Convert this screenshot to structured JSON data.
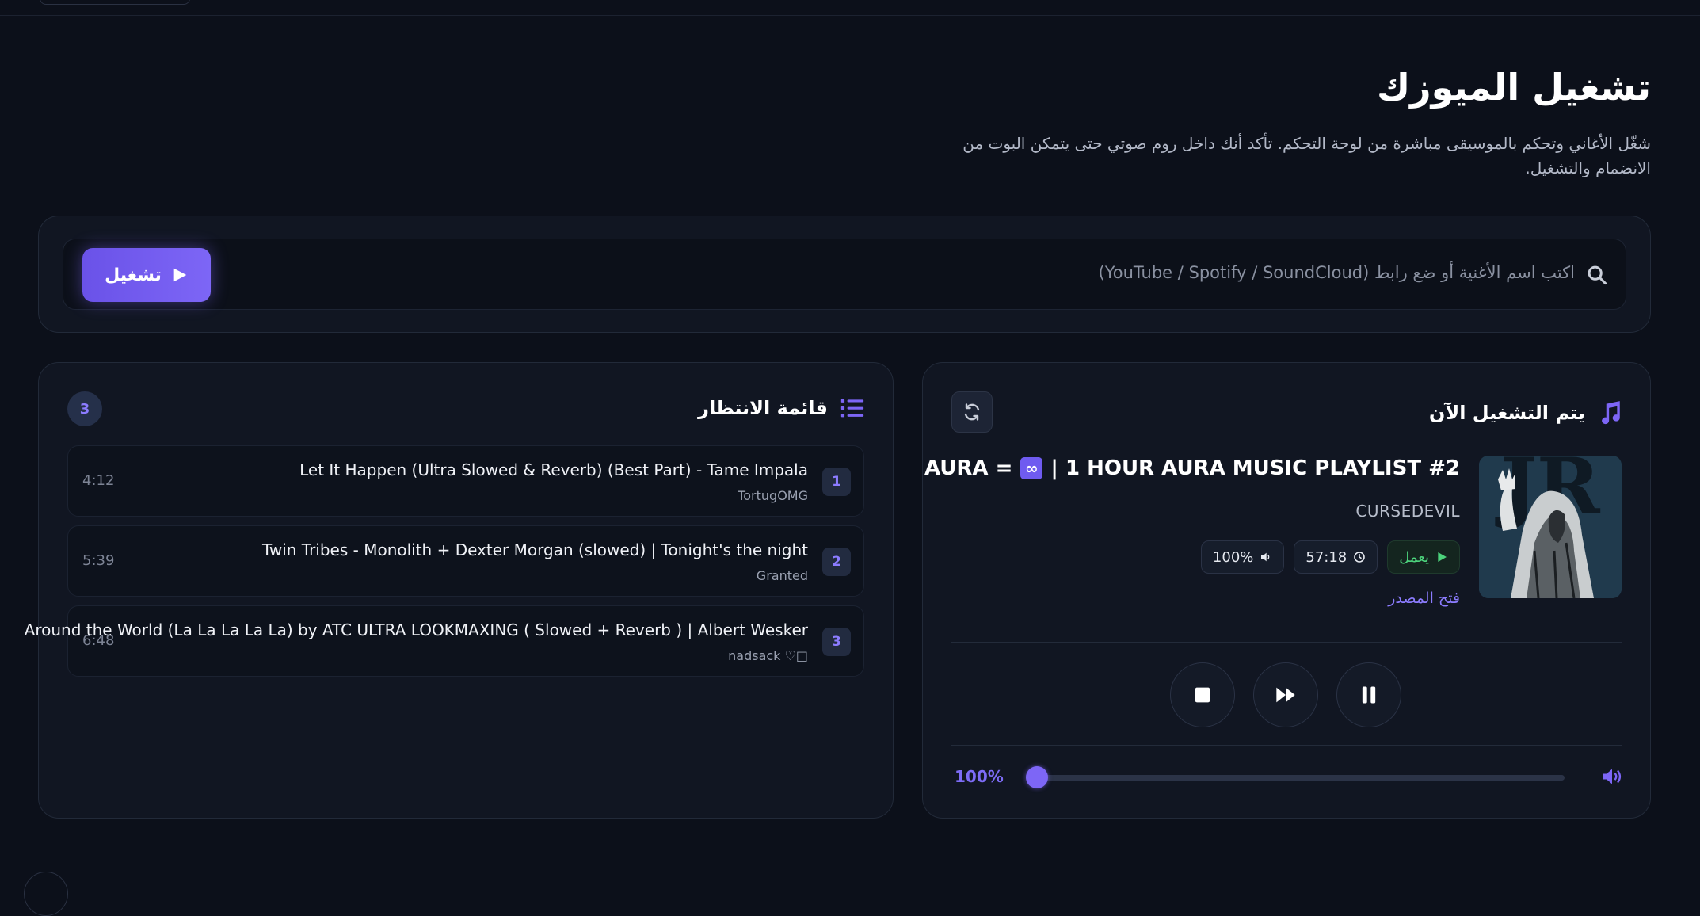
{
  "header": {
    "title": "تشغيل الميوزك",
    "description": "شغّل الأغاني وتحكم بالموسيقى مباشرة من لوحة التحكم. تأكد أنك داخل روم صوتي حتى يتمكن البوت من الانضمام والتشغيل."
  },
  "search": {
    "placeholder": "اكتب اسم الأغنية أو ضع رابط (YouTube / Spotify / SoundCloud)",
    "play_label": "تشغيل"
  },
  "queue": {
    "title": "قائمة الانتظار",
    "count": "3",
    "items": [
      {
        "num": "1",
        "title": "Let It Happen (Ultra Slowed & Reverb) (Best Part) - Tame Impala",
        "artist": "TortugOMG",
        "duration": "4:12"
      },
      {
        "num": "2",
        "title": "Twin Tribes - Monolith + Dexter Morgan (slowed) | Tonight's the night",
        "artist": "Granted",
        "duration": "5:39"
      },
      {
        "num": "3",
        "title": "Around the World (La La La La La) by ATC ULTRA LOOKMAXING ( Slowed + Reverb ) | Albert Wesker",
        "artist": "nadsack ♡□",
        "duration": "6:48"
      }
    ]
  },
  "now_playing": {
    "title": "يتم التشغيل الآن",
    "track_title_prefix": "AURA =",
    "track_title_badge": "∞",
    "track_title_suffix": "| 1 HOUR AURA MUSIC PLAYLIST #2",
    "artist": "CURSEDEVIL",
    "status": "يعمل",
    "elapsed": "57:18",
    "volume_badge": "100%",
    "source_link": "فتح المصدر",
    "volume_label": "100%",
    "volume_value": 100
  },
  "colors": {
    "accent": "#7d66f6",
    "status_green": "#4cd37c",
    "background": "#0c101a",
    "card": "#111622"
  },
  "icons": {
    "search": "search-icon",
    "play": "play-icon",
    "queue": "list-icon",
    "music": "music-note-icon",
    "refresh": "refresh-icon",
    "stop": "stop-icon",
    "skip": "fast-forward-icon",
    "pause": "pause-icon",
    "volume": "volume-icon",
    "clock": "clock-icon"
  }
}
